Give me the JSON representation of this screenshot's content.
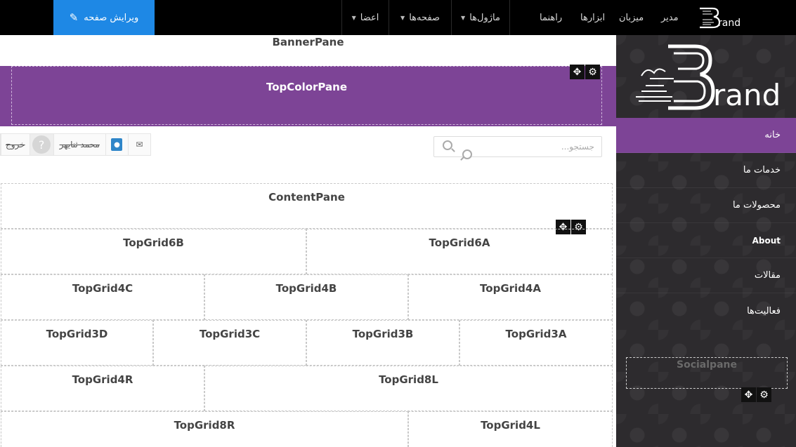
{
  "topbar": {
    "edit_page_label": "ویرایش صفحه",
    "menus": [
      {
        "label": "اعضا"
      },
      {
        "label": "صفحه‌ها"
      },
      {
        "label": "ماژول‌ها"
      }
    ],
    "links": [
      "راهنما",
      "ابزارها",
      "میزبان",
      "مدیر"
    ],
    "admin_logo_text": "rand"
  },
  "sidebar": {
    "logo_text": "rand",
    "nav": [
      {
        "label": "خانه",
        "active": true
      },
      {
        "label": "خدمات ما"
      },
      {
        "label": "محصولات ما"
      },
      {
        "label": "About"
      },
      {
        "label": "مقالات"
      },
      {
        "label": "فعالیت‌ها"
      }
    ],
    "socialpane": "Socialpane"
  },
  "main": {
    "banner": "BannerPane",
    "topcolor": "TopColorPane",
    "search_placeholder": "جستجو...",
    "user": {
      "logout": "خروج",
      "name": "محمد ثنایهر"
    },
    "content": "ContentPane",
    "rows": [
      [
        "TopGrid6A",
        "TopGrid6B"
      ],
      [
        "TopGrid4A",
        "TopGrid4B",
        "TopGrid4C"
      ],
      [
        "TopGrid3A",
        "TopGrid3B",
        "TopGrid3C",
        "TopGrid3D"
      ],
      [
        "TopGrid8L",
        "TopGrid4R"
      ],
      [
        "TopGrid4L",
        "TopGrid8R"
      ]
    ]
  },
  "icons": {
    "move": "move-icon",
    "gear": "gear-icon",
    "pencil": "pencil-icon",
    "search": "search-icon",
    "envelope": "envelope-icon",
    "notification": "notification-icon",
    "avatar": "avatar-icon"
  },
  "colors": {
    "accent_purple": "#7d4496",
    "edit_blue": "#1e88e5",
    "topbar": "#000000",
    "sidebar": "#2d2b2e"
  }
}
